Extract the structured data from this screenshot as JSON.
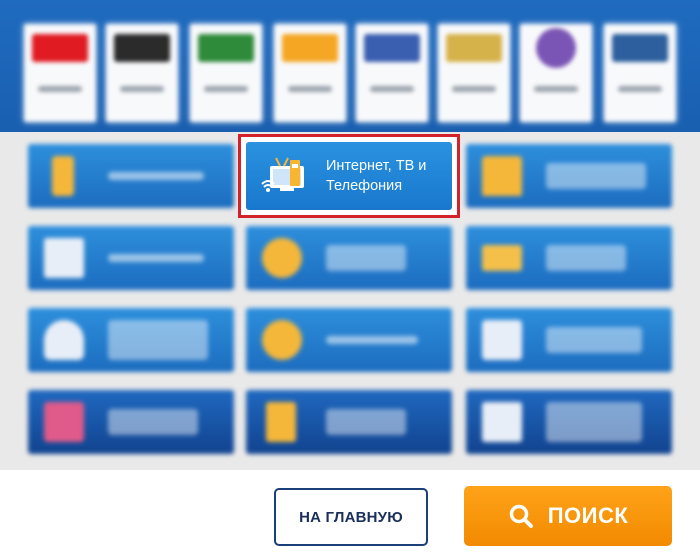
{
  "providers": [
    {
      "name": "provider-1",
      "color": "#e01b22"
    },
    {
      "name": "provider-2",
      "color": "#2b2b2b"
    },
    {
      "name": "provider-3",
      "color": "#2e8b3a"
    },
    {
      "name": "provider-4",
      "color": "#f5a623"
    },
    {
      "name": "provider-5",
      "color": "#3a5fb0"
    },
    {
      "name": "provider-6",
      "color": "#d6b24a"
    },
    {
      "name": "provider-7",
      "color": "#7b55b5"
    },
    {
      "name": "provider-8",
      "color": "#2d5f9e"
    }
  ],
  "categories": {
    "focused": {
      "label": "Интернет, ТВ и Телефония",
      "icon": "tv-wifi-phone-icon"
    },
    "blurred_note": "other category tiles are blurred and unreadable"
  },
  "buttons": {
    "home": "НА ГЛАВНУЮ",
    "search": "ПОИСК"
  },
  "colors": {
    "highlight": "#d3222a",
    "tile_blue": "#1f7ed2",
    "search_orange": "#f59b0a",
    "home_border": "#1b3f7a"
  }
}
